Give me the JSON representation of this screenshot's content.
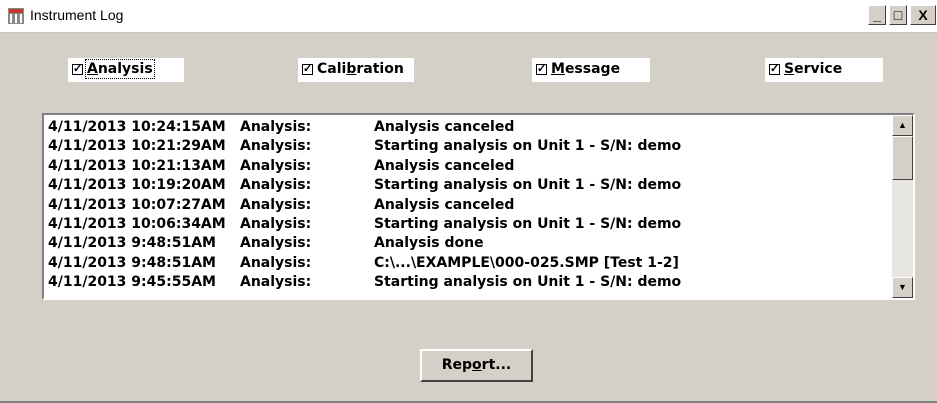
{
  "window": {
    "title": "Instrument Log",
    "minimize_glyph": "_",
    "maximize_glyph": "□",
    "close_glyph": "X"
  },
  "filters": [
    {
      "pre": "",
      "accel": "A",
      "post": "nalysis",
      "checked": true
    },
    {
      "pre": "Cali",
      "accel": "b",
      "post": "ration",
      "checked": true
    },
    {
      "pre": "",
      "accel": "M",
      "post": "essage",
      "checked": true
    },
    {
      "pre": "",
      "accel": "S",
      "post": "ervice",
      "checked": true
    }
  ],
  "check_glyph": "✓",
  "log": {
    "rows": [
      {
        "time": "4/11/2013 10:24:15AM",
        "category": "Analysis:",
        "message": "Analysis canceled"
      },
      {
        "time": "4/11/2013 10:21:29AM",
        "category": "Analysis:",
        "message": "Starting analysis on Unit 1 - S/N: demo"
      },
      {
        "time": "4/11/2013 10:21:13AM",
        "category": "Analysis:",
        "message": "Analysis canceled"
      },
      {
        "time": "4/11/2013 10:19:20AM",
        "category": "Analysis:",
        "message": "Starting analysis on Unit 1 - S/N: demo"
      },
      {
        "time": "4/11/2013 10:07:27AM",
        "category": "Analysis:",
        "message": "Analysis canceled"
      },
      {
        "time": "4/11/2013 10:06:34AM",
        "category": "Analysis:",
        "message": "Starting analysis on Unit 1 - S/N: demo"
      },
      {
        "time": "4/11/2013 9:48:51AM",
        "category": "Analysis:",
        "message": "Analysis done"
      },
      {
        "time": "4/11/2013 9:48:51AM",
        "category": "Analysis:",
        "message": "C:\\...\\EXAMPLE\\000-025.SMP [Test 1-2]"
      },
      {
        "time": "4/11/2013 9:45:55AM",
        "category": "Analysis:",
        "message": "Starting analysis on Unit 1 - S/N: demo"
      }
    ],
    "scroll_up_glyph": "▲",
    "scroll_down_glyph": "▼"
  },
  "report_button": {
    "pre": "Rep",
    "accel": "o",
    "post": "rt..."
  },
  "colors": {
    "dialog_bg": "#d4d0c8",
    "list_bg": "#ffffff",
    "text": "#000000"
  }
}
